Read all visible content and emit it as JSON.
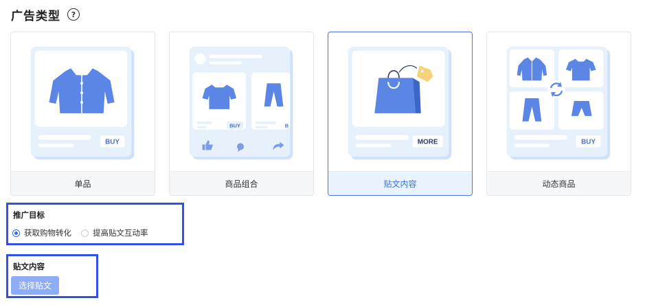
{
  "header": {
    "title": "广告类型",
    "help_icon": "question-circle-icon",
    "help_glyph": "?"
  },
  "cards": [
    {
      "label": "单品",
      "buy": "BUY",
      "selected": false
    },
    {
      "label": "商品组合",
      "buy": "BUY",
      "buy_cut": "B",
      "selected": false
    },
    {
      "label": "贴文内容",
      "more": "MORE",
      "selected": true
    },
    {
      "label": "动态商品",
      "buy": "BUY",
      "selected": false
    }
  ],
  "goal": {
    "title": "推广目标",
    "options": [
      {
        "label": "获取购物转化",
        "checked": true
      },
      {
        "label": "提高贴文互动率",
        "checked": false
      }
    ]
  },
  "content": {
    "title": "贴文内容",
    "button": "选择贴文"
  },
  "colors": {
    "accent": "#2f6df0",
    "highlight_border": "#2e52e6",
    "illustration_blue": "#5b86e5",
    "panel_light": "#e6f1fc",
    "button_bg": "#8fadf6"
  }
}
